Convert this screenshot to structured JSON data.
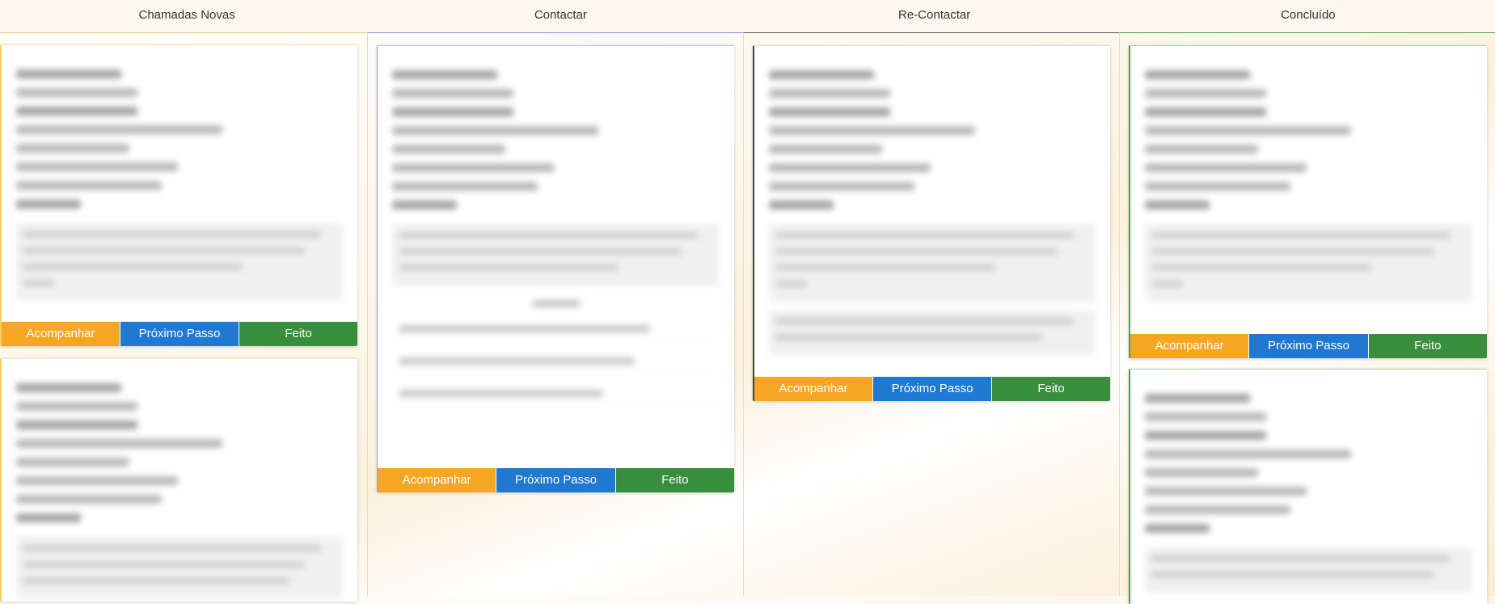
{
  "columns": [
    {
      "title": "Chamadas Novas"
    },
    {
      "title": "Contactar"
    },
    {
      "title": "Re-Contactar"
    },
    {
      "title": "Concluído"
    }
  ],
  "card_actions": {
    "follow_label": "Acompanhar",
    "next_step_label": "Próximo Passo",
    "done_label": "Feito"
  },
  "colors": {
    "follow": "#f5a623",
    "next_step": "#1f78d1",
    "done": "#388e3c",
    "header_border": "#e4c27a"
  }
}
